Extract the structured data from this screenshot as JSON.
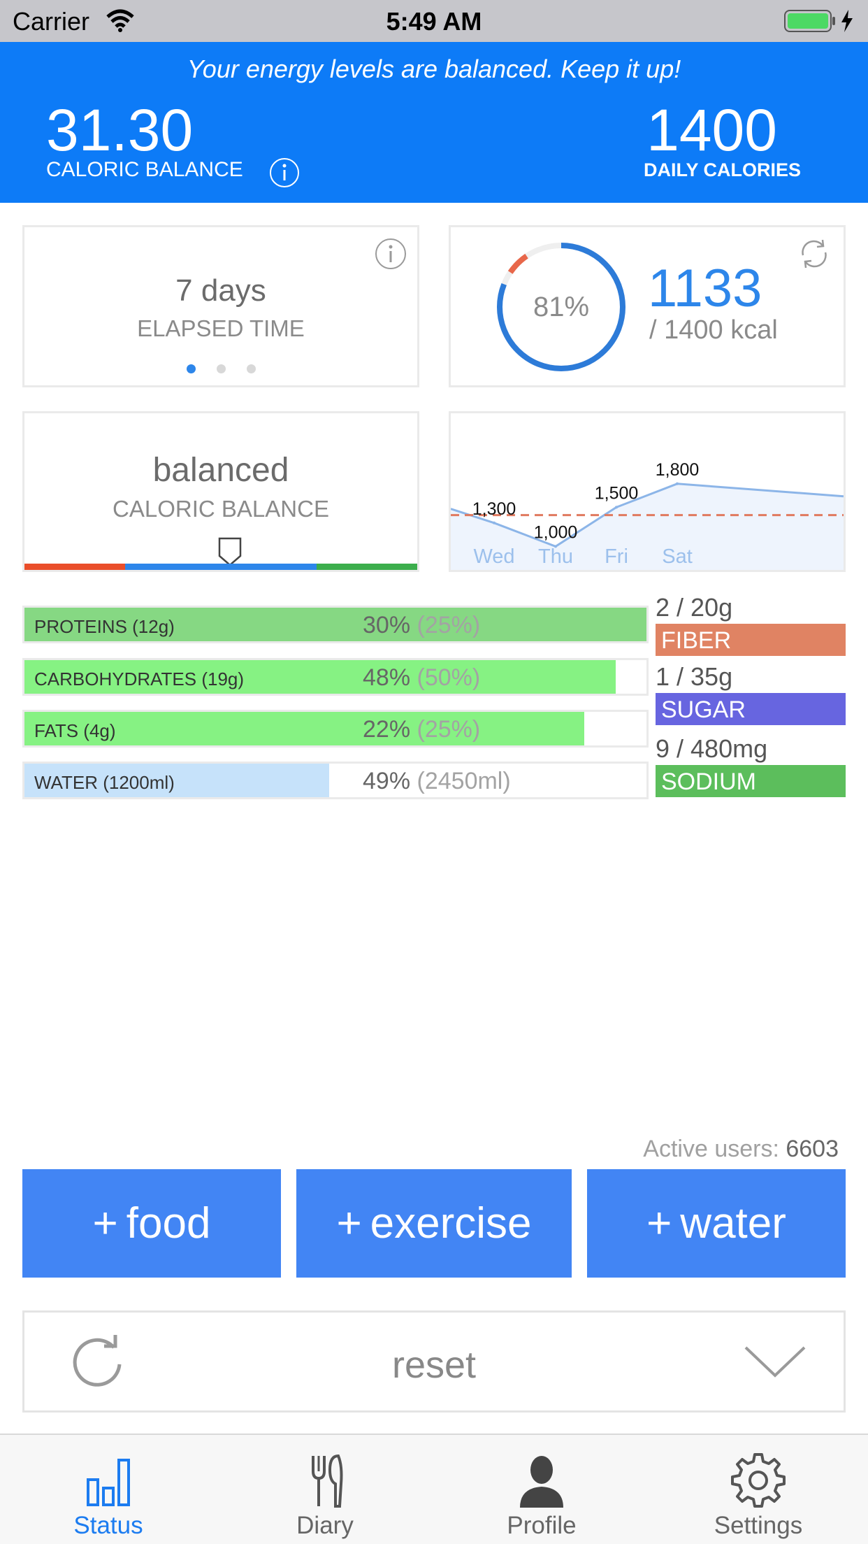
{
  "status_bar": {
    "carrier": "Carrier",
    "time": "5:49 AM"
  },
  "header": {
    "message": "Your energy levels are balanced. Keep it up!",
    "caloric_balance_value": "31.30",
    "caloric_balance_label": "CALORIC BALANCE",
    "daily_calories_value": "1400",
    "daily_calories_label": "DAILY CALORIES"
  },
  "elapsed": {
    "value": "7 days",
    "label": "ELAPSED TIME",
    "page_dots": 3,
    "active_dot": 0
  },
  "calories": {
    "percent": "81%",
    "consumed": "1133",
    "total": "/ 1400 kcal",
    "progress": 0.81
  },
  "balance": {
    "value": "balanced",
    "label": "CALORIC BALANCE"
  },
  "chart_data": {
    "type": "line",
    "categories": [
      "Wed",
      "Thu",
      "Fri",
      "Sat"
    ],
    "series": [
      {
        "values": [
          1300,
          1000,
          1500,
          1800
        ]
      }
    ],
    "data_labels": [
      "1,300",
      "1,000",
      "1,500",
      "1,800"
    ],
    "target_line": 1400,
    "colors": {
      "line": "#8cb5e8",
      "fill": "#eef4fd",
      "target": "#e07a5f",
      "label": "#9cc0ec"
    }
  },
  "nutrients": [
    {
      "label": "PROTEINS (12g)",
      "percent": "30%",
      "target": "(25%)",
      "fill": 1.0,
      "color": "#86d883"
    },
    {
      "label": "CARBOHYDRATES (19g)",
      "percent": "48%",
      "target": "(50%)",
      "fill": 0.95,
      "color": "#86f283"
    },
    {
      "label": "FATS (4g)",
      "percent": "22%",
      "target": "(25%)",
      "fill": 0.9,
      "color": "#86f283"
    },
    {
      "label": "WATER (1200ml)",
      "percent": "49%",
      "target": "(2450ml)",
      "fill": 0.49,
      "color": "#c6e2fa"
    }
  ],
  "minerals": [
    {
      "amount": "2 / 20g",
      "name": "FIBER",
      "color": "#e08363"
    },
    {
      "amount": "1 / 35g",
      "name": "SUGAR",
      "color": "#6765e0"
    },
    {
      "amount": "9 / 480mg",
      "name": "SODIUM",
      "color": "#5cbe5c"
    }
  ],
  "active_users": {
    "label": "Active users:",
    "count": "6603"
  },
  "actions": {
    "food": {
      "plus": "+",
      "label": "food"
    },
    "exercise": {
      "plus": "+",
      "label": "exercise"
    },
    "water": {
      "plus": "+",
      "label": "water"
    }
  },
  "reset": {
    "label": "reset"
  },
  "tabs": [
    {
      "label": "Status",
      "icon": "bar-chart-icon",
      "active": true
    },
    {
      "label": "Diary",
      "icon": "fork-knife-icon",
      "active": false
    },
    {
      "label": "Profile",
      "icon": "person-icon",
      "active": false
    },
    {
      "label": "Settings",
      "icon": "gear-icon",
      "active": false
    }
  ],
  "colors": {
    "header": "#0d7bf7",
    "accent": "#2d86ea",
    "action_button": "#4285f4"
  }
}
